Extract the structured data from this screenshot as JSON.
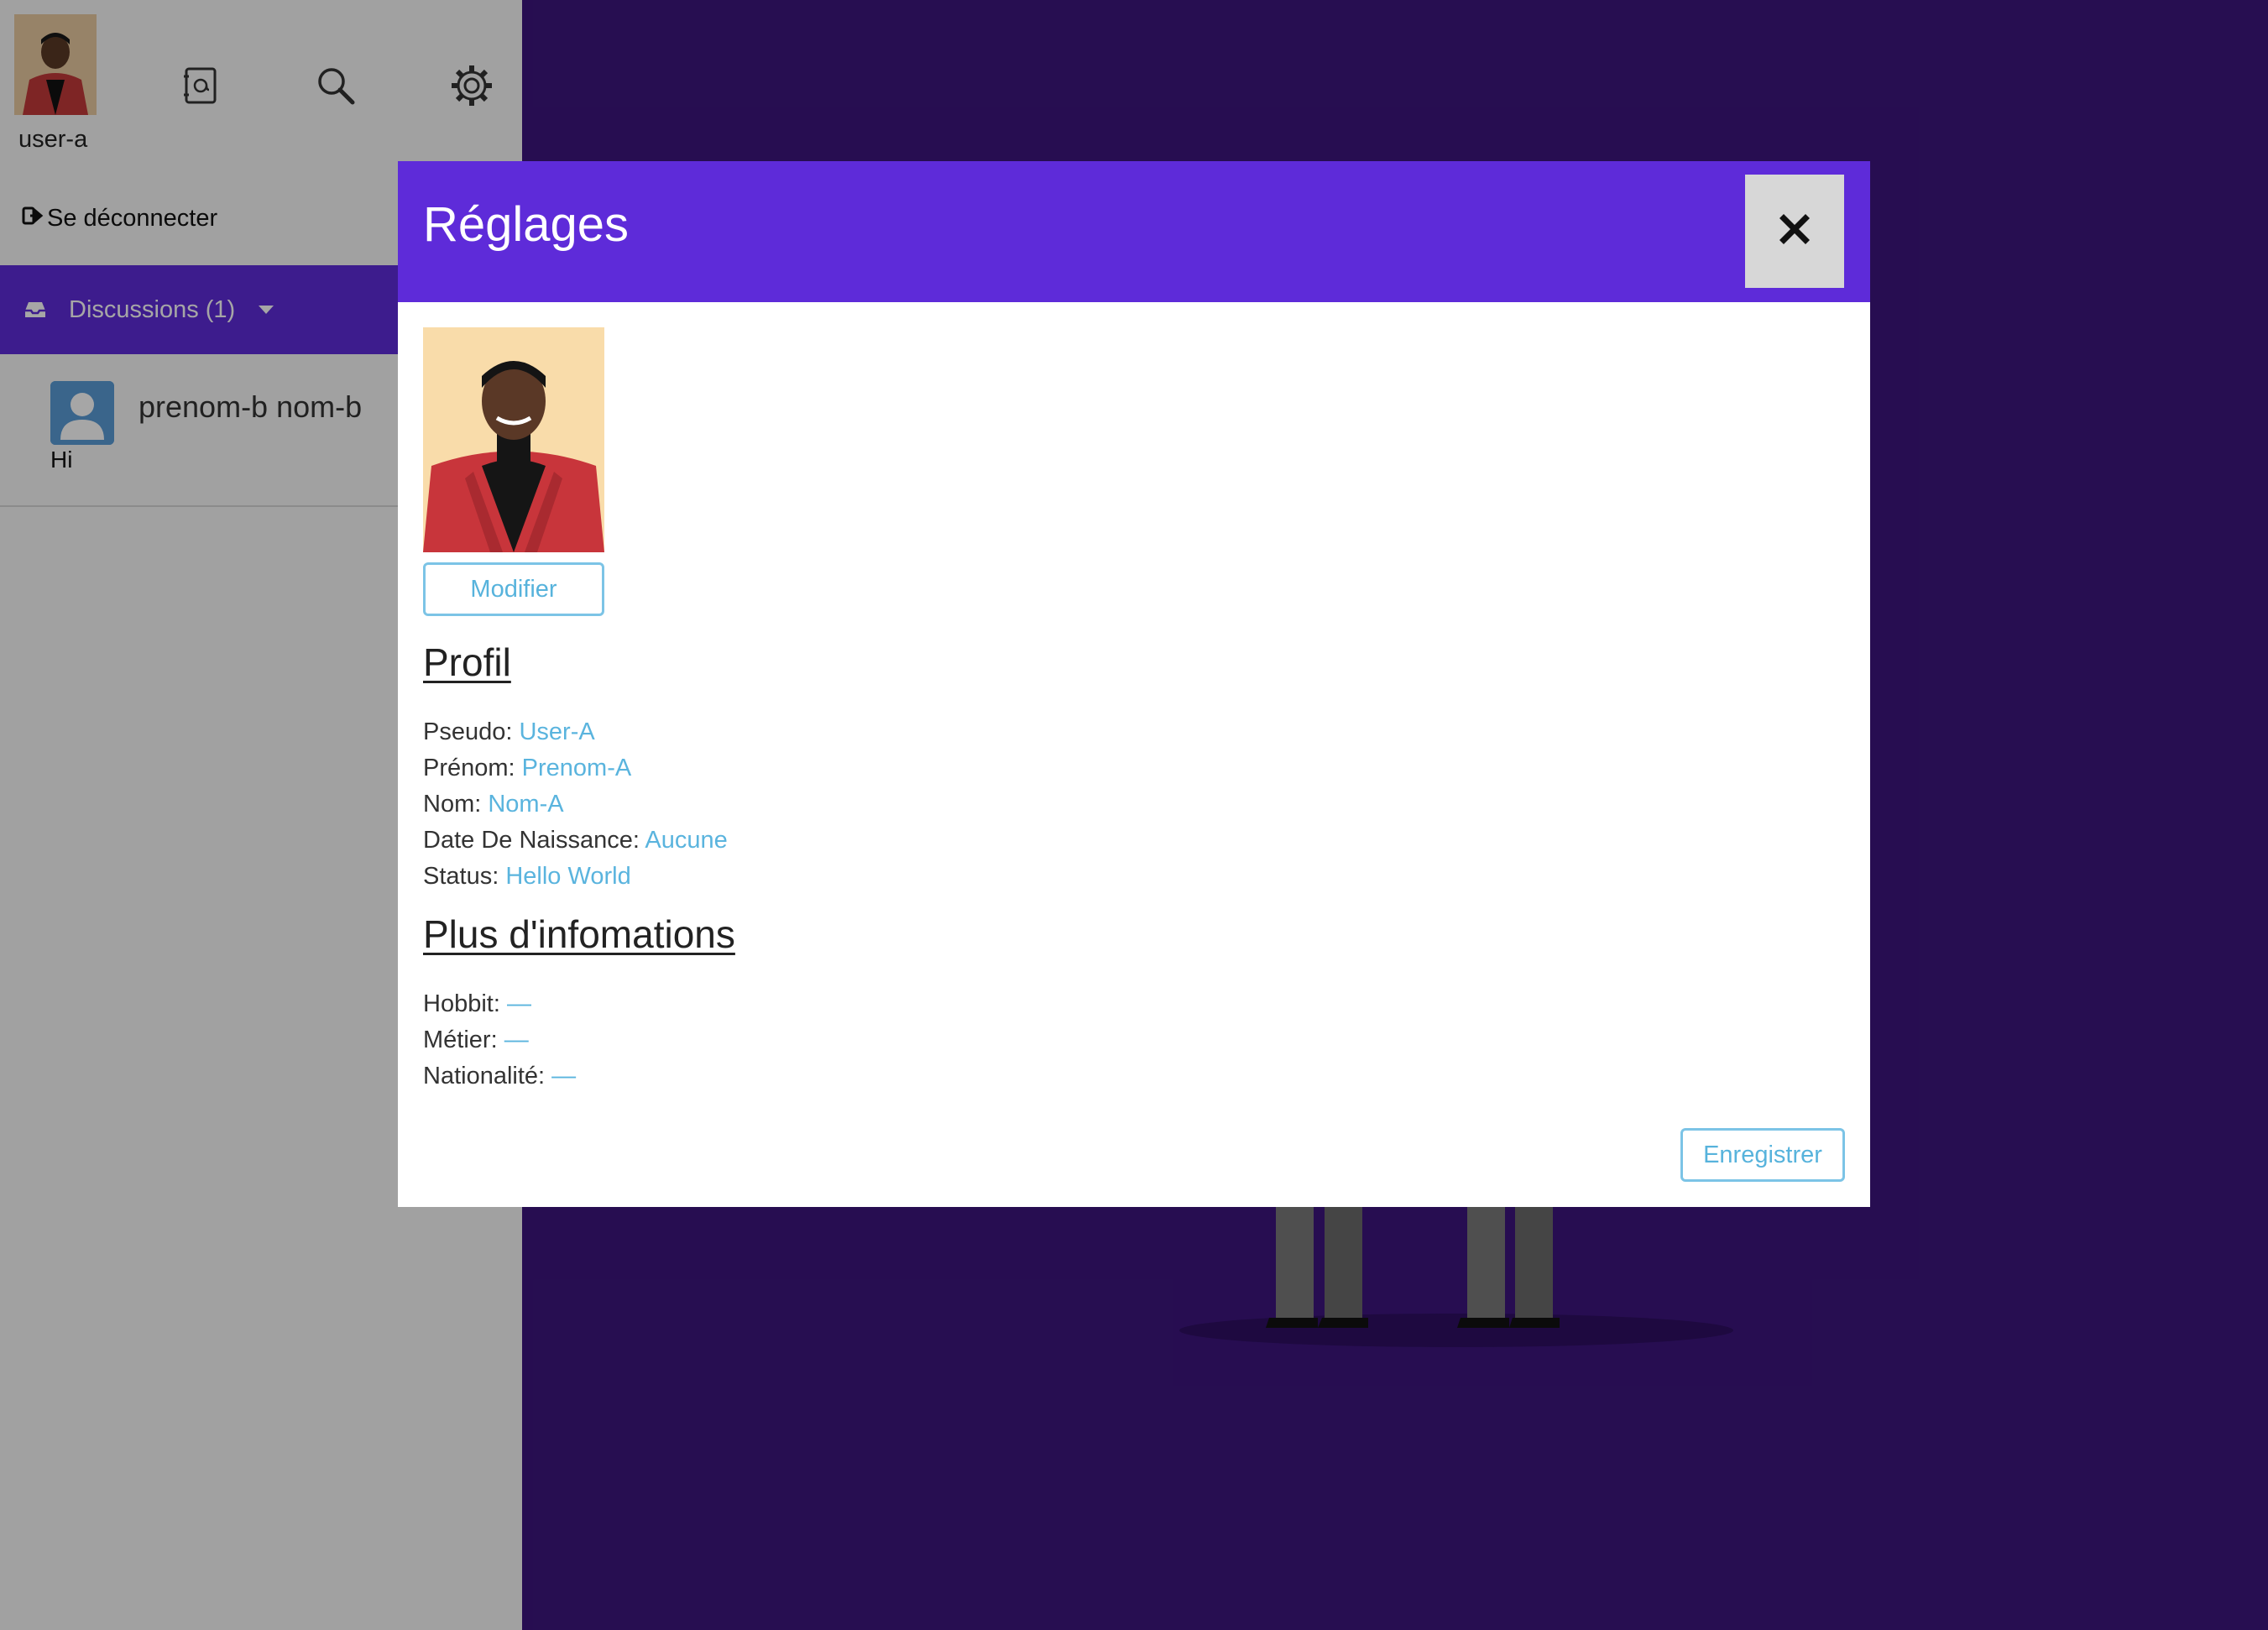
{
  "sidebar": {
    "username": "user-a",
    "logout_label": "Se déconnecter",
    "discussions_label": "Discussions (1)",
    "conversations": [
      {
        "name": "prenom-b nom-b",
        "last_message": "Hi"
      }
    ]
  },
  "modal": {
    "title": "Réglages",
    "modify_label": "Modifier",
    "save_label": "Enregistrer",
    "profile_section": "Profil",
    "profile_fields": [
      {
        "label": "Pseudo:",
        "value": "User-A"
      },
      {
        "label": "Prénom:",
        "value": "Prenom-A"
      },
      {
        "label": "Nom:",
        "value": "Nom-A"
      },
      {
        "label": "Date De Naissance:",
        "value": "Aucune"
      },
      {
        "label": "Status:",
        "value": "Hello World"
      }
    ],
    "more_section": "Plus d'infomations",
    "more_fields": [
      {
        "label": "Hobbit:",
        "value": "—"
      },
      {
        "label": "Métier:",
        "value": "—"
      },
      {
        "label": "Nationalité:",
        "value": "—"
      }
    ]
  },
  "colors": {
    "accent": "#5e2bd9",
    "background": "#3c157d",
    "link": "#5ab4de"
  },
  "icons": [
    "contacts-icon",
    "search-icon",
    "gear-icon",
    "logout-icon",
    "inbox-icon",
    "close-icon"
  ]
}
